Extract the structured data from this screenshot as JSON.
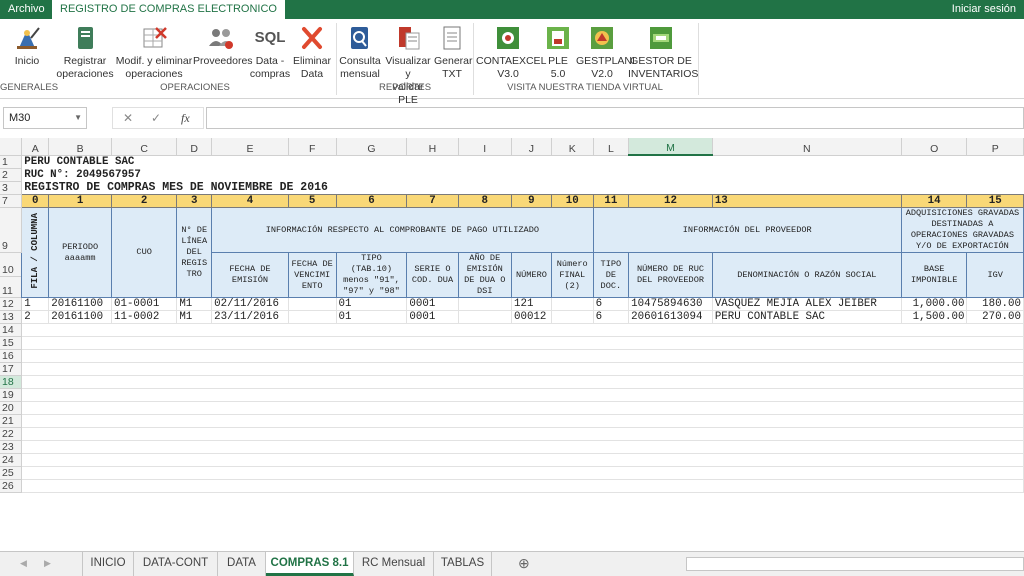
{
  "window": {
    "file_tab": "Archivo",
    "main_tab": "REGISTRO DE COMPRAS ELECTRONICO",
    "signin": "Iniciar sesión"
  },
  "ribbon": {
    "buttons": [
      {
        "label1": "Inicio",
        "label2": "",
        "icon": "home-wizard-icon"
      },
      {
        "label1": "Registrar",
        "label2": "operaciones",
        "icon": "register-book-icon"
      },
      {
        "label1": "Modif. y eliminar",
        "label2": "operaciones",
        "icon": "edit-delete-icon"
      },
      {
        "label1": "Proveedores",
        "label2": "",
        "icon": "suppliers-icon"
      },
      {
        "label1": "Data -",
        "label2": "compras",
        "icon": "sql-icon"
      },
      {
        "label1": "Eliminar",
        "label2": "Data",
        "icon": "delete-x-icon"
      },
      {
        "label1": "Consulta",
        "label2": "mensual",
        "icon": "monthly-query-icon"
      },
      {
        "label1": "Visualizar y",
        "label2": "validar PLE",
        "icon": "validate-ple-icon"
      },
      {
        "label1": "Generar",
        "label2": "TXT",
        "icon": "txt-icon"
      },
      {
        "label1": "CONTAEXCEL",
        "label2": "V3.0",
        "icon": "contaexcel-icon"
      },
      {
        "label1": "PLE",
        "label2": "5.0",
        "icon": "ple-icon"
      },
      {
        "label1": "GESTPLANI",
        "label2": "V2.0",
        "icon": "gestplani-icon"
      },
      {
        "label1": "GESTOR DE",
        "label2": "INVENTARIOS",
        "icon": "inventory-icon"
      }
    ],
    "groups": [
      "GENERALES",
      "OPERACIONES",
      "REPORTES",
      "VISITA NUESTRA TIENDA VIRTUAL"
    ],
    "sql_text": "SQL"
  },
  "formula_bar": {
    "name_box": "M30",
    "cancel": "✕",
    "confirm": "✓",
    "fx": "fx",
    "value": ""
  },
  "columns": [
    "A",
    "B",
    "C",
    "D",
    "E",
    "F",
    "G",
    "H",
    "I",
    "J",
    "K",
    "L",
    "M",
    "N",
    "O",
    "P"
  ],
  "rows": [
    "1",
    "2",
    "3",
    "7",
    "9",
    "10",
    "11",
    "12",
    "13",
    "14",
    "15",
    "16",
    "17",
    "18",
    "19",
    "20",
    "21",
    "22",
    "23",
    "24",
    "25",
    "26"
  ],
  "header_text": {
    "company": "PERÚ CONTABLE SAC",
    "ruc": "RUC N°: 2049567957",
    "title": "REGISTRO DE COMPRAS MES DE NOVIEMBRE DE 2016"
  },
  "col_numbers": [
    "0",
    "1",
    "2",
    "3",
    "4",
    "5",
    "6",
    "7",
    "8",
    "9",
    "10",
    "11",
    "12",
    "13",
    "14",
    "15"
  ],
  "headers": {
    "fila_columna": "FILA / COLUMNA",
    "periodo": "PERIODO aaaamm",
    "cuo": "CUO",
    "nlinea": "N° DE LÍNEA DEL REGIS TRO",
    "comprobante": "INFORMACIÓN RESPECTO AL COMPROBANTE DE PAGO UTILIZADO",
    "proveedor": "INFORMACIÓN DEL PROVEEDOR",
    "adquisiciones": "ADQUISICIONES GRAVADAS DESTINADAS A OPERACIONES GRAVADAS Y/O DE EXPORTACIÓN",
    "fecha_emision": "FECHA DE EMISIÓN",
    "fecha_venc": "FECHA DE VENCIMI ENTO",
    "tipo": "TIPO (TAB.10) menos \"91\", \"97\" y \"98\"",
    "serie": "SERIE O COD. DUA",
    "anio": "AÑO DE EMISIÓN DE DUA O DSI",
    "numero": "NÚMERO",
    "numero_final": "Número FINAL (2)",
    "tipo_doc": "TIPO DE DOC.",
    "ruc_prov": "NÚMERO DE RUC DEL PROVEEDOR",
    "denominacion": "DENOMINACIÓN O RAZÓN SOCIAL",
    "base": "BASE IMPONIBLE",
    "igv": "IGV"
  },
  "records": [
    {
      "fila": "1",
      "periodo": "20161100",
      "cuo": "01-0001",
      "linea": "M1",
      "fecha": "02/11/2016",
      "venc": "",
      "tipo": "01",
      "serie": "0001",
      "anio": "",
      "numero": "121",
      "numfin": "",
      "tipodoc": "6",
      "ruc": "10475894630",
      "razon": "VASQUEZ MEJIA ALEX JEIBER",
      "base": "1,000.00",
      "igv": "180.00"
    },
    {
      "fila": "2",
      "periodo": "20161100",
      "cuo": "11-0002",
      "linea": "M1",
      "fecha": "23/11/2016",
      "venc": "",
      "tipo": "01",
      "serie": "0001",
      "anio": "",
      "numero": "00012",
      "numfin": "",
      "tipodoc": "6",
      "ruc": "20601613094",
      "razon": "PERU CONTABLE SAC",
      "base": "1,500.00",
      "igv": "270.00"
    }
  ],
  "sheet_tabs": [
    "INICIO",
    "DATA-CONT",
    "DATA",
    "COMPRAS 8.1",
    "RC Mensual",
    "TABLAS"
  ],
  "active_sheet": "COMPRAS 8.1",
  "add_sheet": "⊕",
  "colors": {
    "excel_green": "#217346",
    "header_blue": "#ddebf7",
    "col_num_yellow": "#f9d877"
  }
}
